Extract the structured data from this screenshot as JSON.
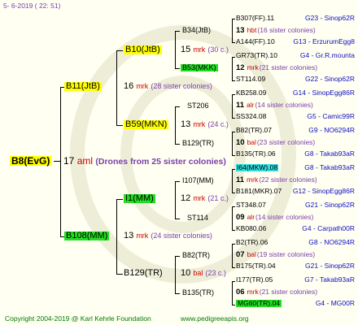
{
  "header": {
    "date": "5-  6-2019 ( 22:  51)"
  },
  "footer": {
    "copyright": "Copyright 2004-2019 @ Karl Kehrle Foundation",
    "url": "www.pedigreeapis.org"
  },
  "colors": {
    "yellow": "#ffff00",
    "green": "#22dd22",
    "cyan": "#33dddd"
  },
  "root": {
    "name": "B8(EvG)",
    "year": "17",
    "breed": "aml",
    "note": "(Drones from 25 sister colonies)"
  },
  "g2": [
    {
      "name": "B11(JtB)",
      "year": "16",
      "breed": "mrk",
      "note": "(28 sister colonies)"
    },
    {
      "name": "B108(MM)",
      "year": "13",
      "breed": "mrk",
      "note": "(24 sister colonies)"
    }
  ],
  "g3": [
    {
      "name": "B10(JtB)",
      "year": "15",
      "breed": "mrk",
      "note": "(30 c.)"
    },
    {
      "name": "B59(MKN)",
      "year": "13",
      "breed": "mrk",
      "note": "(24 c.)"
    },
    {
      "name": "I1(MM)",
      "year": "12",
      "breed": "mrk",
      "note": "(21 c.)"
    },
    {
      "name": "B129(TR)",
      "year": "10",
      "breed": "bal",
      "note": "(23 c.)"
    }
  ],
  "g4": [
    {
      "name": "B34(JtB)"
    },
    {
      "name": "B53(MKK)"
    },
    {
      "name": "ST206"
    },
    {
      "name": "B129(TR)"
    },
    {
      "name": "I107(MM)"
    },
    {
      "name": "ST114"
    },
    {
      "name": "B82(TR)"
    },
    {
      "name": "B135(TR)"
    }
  ],
  "g5": [
    {
      "name": "B307(FF).11",
      "ref": "G23 - Sinop62R"
    },
    {
      "year": "13",
      "breed": "hbt",
      "note": "(16 sister colonies)"
    },
    {
      "name": "A144(FF).10",
      "ref": "G13 - ErzurumEgg8"
    },
    {
      "name": "GR73(TR).10",
      "ref": "G4 - Gr.R.mounta"
    },
    {
      "year": "12",
      "breed": "mrk",
      "note": "(21 sister colonies)"
    },
    {
      "name": "ST114.09",
      "ref": "G22 - Sinop62R"
    },
    {
      "name": "KB258.09",
      "ref": "G14 - SinopEgg86R"
    },
    {
      "year": "11",
      "breed": "alr",
      "note": "(14 sister colonies)"
    },
    {
      "name": "SS324.08",
      "ref": "G5 - Camic99R"
    },
    {
      "name": "B82(TR).07",
      "ref": "G9 - NO6294R"
    },
    {
      "year": "10",
      "breed": "bal",
      "note": "(23 sister colonies)"
    },
    {
      "name": "B135(TR).06",
      "ref": "G8 - Takab93aR"
    },
    {
      "name": "I64(MKW).08",
      "ref": "G8 - Takab93aR"
    },
    {
      "year": "11",
      "breed": "mrk",
      "note": "(22 sister colonies)"
    },
    {
      "name": "B181(MKR).07",
      "ref": "G12 - SinopEgg86R"
    },
    {
      "name": "ST348.07",
      "ref": "G21 - Sinop62R"
    },
    {
      "year": "09",
      "breed": "alr",
      "note": "(14 sister colonies)"
    },
    {
      "name": "KB080.06",
      "ref": "G4 - Carpath00R"
    },
    {
      "name": "B2(TR).06",
      "ref": "G8 - NO6294R"
    },
    {
      "year": "07",
      "breed": "bal",
      "note": "(19 sister colonies)"
    },
    {
      "name": "B175(TR).04",
      "ref": "G21 - Sinop62R"
    },
    {
      "name": "I177(TR).05",
      "ref": "G7 - Takab93aR"
    },
    {
      "year": "06",
      "breed": "mrk",
      "note": "(21 sister colonies)"
    },
    {
      "name": "MG60(TR).04",
      "ref": "G4 - MG00R"
    }
  ]
}
